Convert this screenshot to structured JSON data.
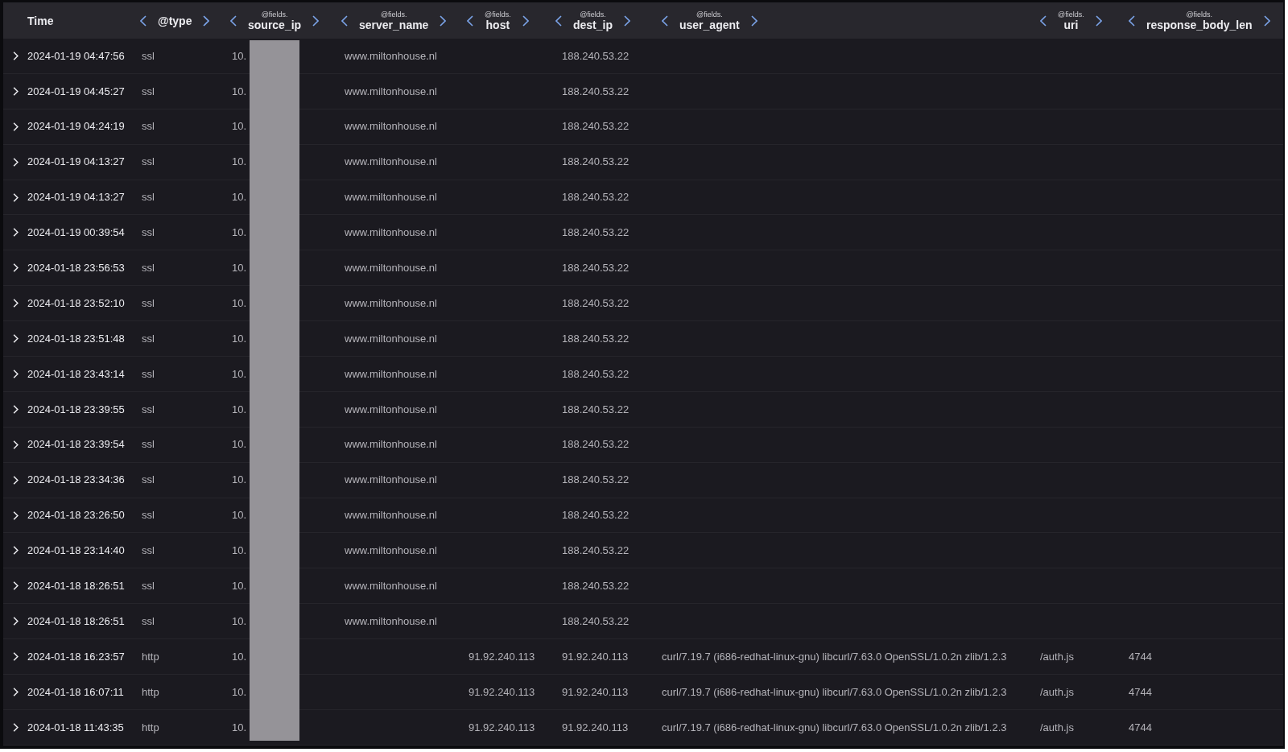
{
  "table": {
    "source_ip_redacted": true,
    "columns": [
      {
        "label": "Time",
        "arrows": false
      },
      {
        "label": "@type",
        "arrows": true
      },
      {
        "prefix": "@fields.",
        "label": "source_ip",
        "arrows": true
      },
      {
        "prefix": "@fields.",
        "label": "server_name",
        "arrows": true
      },
      {
        "prefix": "@fields.",
        "label": "host",
        "arrows": true
      },
      {
        "prefix": "@fields.",
        "label": "dest_ip",
        "arrows": true
      },
      {
        "prefix": "@fields.",
        "label": "user_agent",
        "arrows": true
      },
      {
        "prefix": "@fields.",
        "label": "uri",
        "arrows": true
      },
      {
        "prefix": "@fields.",
        "label": "response_body_len",
        "arrows": true
      }
    ],
    "rows": [
      {
        "cells": [
          "2024-01-19 04:47:56",
          "ssl",
          "10.",
          "www.miltonhouse.nl",
          "",
          "188.240.53.22",
          "",
          "",
          ""
        ]
      },
      {
        "cells": [
          "2024-01-19 04:45:27",
          "ssl",
          "10.",
          "www.miltonhouse.nl",
          "",
          "188.240.53.22",
          "",
          "",
          ""
        ]
      },
      {
        "cells": [
          "2024-01-19 04:24:19",
          "ssl",
          "10.",
          "www.miltonhouse.nl",
          "",
          "188.240.53.22",
          "",
          "",
          ""
        ]
      },
      {
        "cells": [
          "2024-01-19 04:13:27",
          "ssl",
          "10.",
          "www.miltonhouse.nl",
          "",
          "188.240.53.22",
          "",
          "",
          ""
        ]
      },
      {
        "cells": [
          "2024-01-19 04:13:27",
          "ssl",
          "10.",
          "www.miltonhouse.nl",
          "",
          "188.240.53.22",
          "",
          "",
          ""
        ]
      },
      {
        "cells": [
          "2024-01-19 00:39:54",
          "ssl",
          "10.",
          "www.miltonhouse.nl",
          "",
          "188.240.53.22",
          "",
          "",
          ""
        ]
      },
      {
        "cells": [
          "2024-01-18 23:56:53",
          "ssl",
          "10.",
          "www.miltonhouse.nl",
          "",
          "188.240.53.22",
          "",
          "",
          ""
        ]
      },
      {
        "cells": [
          "2024-01-18 23:52:10",
          "ssl",
          "10.",
          "www.miltonhouse.nl",
          "",
          "188.240.53.22",
          "",
          "",
          ""
        ]
      },
      {
        "cells": [
          "2024-01-18 23:51:48",
          "ssl",
          "10.",
          "www.miltonhouse.nl",
          "",
          "188.240.53.22",
          "",
          "",
          ""
        ]
      },
      {
        "cells": [
          "2024-01-18 23:43:14",
          "ssl",
          "10.",
          "www.miltonhouse.nl",
          "",
          "188.240.53.22",
          "",
          "",
          ""
        ]
      },
      {
        "cells": [
          "2024-01-18 23:39:55",
          "ssl",
          "10.",
          "www.miltonhouse.nl",
          "",
          "188.240.53.22",
          "",
          "",
          ""
        ]
      },
      {
        "cells": [
          "2024-01-18 23:39:54",
          "ssl",
          "10.",
          "www.miltonhouse.nl",
          "",
          "188.240.53.22",
          "",
          "",
          ""
        ]
      },
      {
        "cells": [
          "2024-01-18 23:34:36",
          "ssl",
          "10.",
          "www.miltonhouse.nl",
          "",
          "188.240.53.22",
          "",
          "",
          ""
        ]
      },
      {
        "cells": [
          "2024-01-18 23:26:50",
          "ssl",
          "10.",
          "www.miltonhouse.nl",
          "",
          "188.240.53.22",
          "",
          "",
          ""
        ]
      },
      {
        "cells": [
          "2024-01-18 23:14:40",
          "ssl",
          "10.",
          "www.miltonhouse.nl",
          "",
          "188.240.53.22",
          "",
          "",
          ""
        ]
      },
      {
        "cells": [
          "2024-01-18 18:26:51",
          "ssl",
          "10.",
          "www.miltonhouse.nl",
          "",
          "188.240.53.22",
          "",
          "",
          ""
        ]
      },
      {
        "cells": [
          "2024-01-18 18:26:51",
          "ssl",
          "10.",
          "www.miltonhouse.nl",
          "",
          "188.240.53.22",
          "",
          "",
          ""
        ]
      },
      {
        "cells": [
          "2024-01-18 16:23:57",
          "http",
          "10.",
          "",
          "91.92.240.113",
          "91.92.240.113",
          "curl/7.19.7 (i686-redhat-linux-gnu) libcurl/7.63.0 OpenSSL/1.0.2n zlib/1.2.3",
          "/auth.js",
          "4744"
        ]
      },
      {
        "cells": [
          "2024-01-18 16:07:11",
          "http",
          "10.",
          "",
          "91.92.240.113",
          "91.92.240.113",
          "curl/7.19.7 (i686-redhat-linux-gnu) libcurl/7.63.0 OpenSSL/1.0.2n zlib/1.2.3",
          "/auth.js",
          "4744"
        ]
      },
      {
        "cells": [
          "2024-01-18 11:43:35",
          "http",
          "10.",
          "",
          "91.92.240.113",
          "91.92.240.113",
          "curl/7.19.7 (i686-redhat-linux-gnu) libcurl/7.63.0 OpenSSL/1.0.2n zlib/1.2.3",
          "/auth.js",
          "4744"
        ]
      }
    ]
  }
}
